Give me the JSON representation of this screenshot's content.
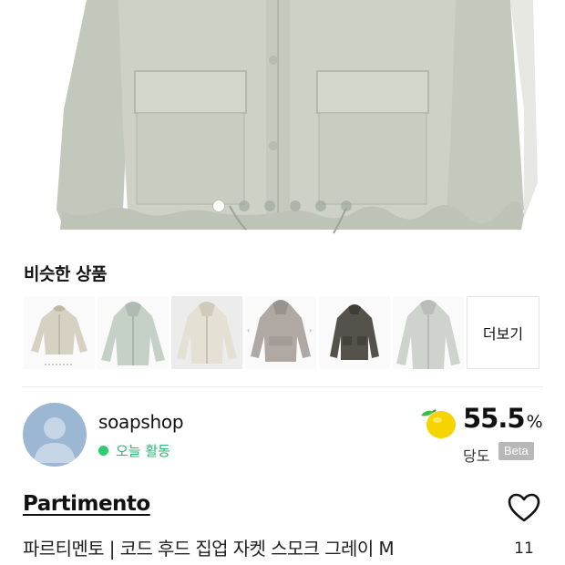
{
  "hero": {
    "image": "gray-hooded-jacket-photo",
    "slide_count": 6,
    "active_slide": 1
  },
  "similar": {
    "title": "비슷한 상품",
    "items": [
      {
        "image": "beige-jacket-thumb"
      },
      {
        "image": "mint-hooded-jacket-thumb"
      },
      {
        "image": "cream-zip-jacket-thumb"
      },
      {
        "image": "taupe-anorak-thumb"
      },
      {
        "image": "brown-pocket-jacket-thumb"
      },
      {
        "image": "gray-hooded-jacket-thumb"
      }
    ],
    "more_label": "더보기"
  },
  "seller": {
    "name": "soapshop",
    "activity": "오늘 활동",
    "activity_color": "#2bb673",
    "avatar_color": "#9cb7d3",
    "trust_score": "55.5",
    "trust_unit": "%",
    "trust_label": "당도",
    "trust_badge": "Beta",
    "trust_icon": "yellow-lemon-icon"
  },
  "product": {
    "brand": "Partimento",
    "title": "파르티멘토 | 코드 후드 집업 자켓 스모크 그레이 M",
    "like_count": "11",
    "like_icon": "heart-outline-icon"
  }
}
